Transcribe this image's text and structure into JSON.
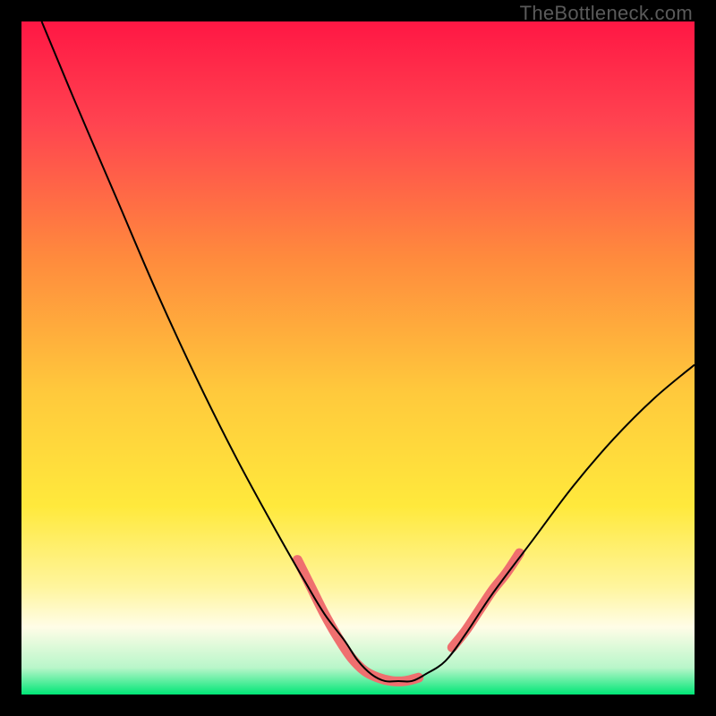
{
  "watermark": "TheBottleneck.com",
  "chart_data": {
    "type": "line",
    "title": "",
    "xlabel": "",
    "ylabel": "",
    "xlim": [
      0,
      100
    ],
    "ylim": [
      0,
      100
    ],
    "background_gradient": {
      "type": "vertical",
      "stops": [
        {
          "pos": 0.0,
          "color": "#ff1744"
        },
        {
          "pos": 0.15,
          "color": "#ff4350"
        },
        {
          "pos": 0.35,
          "color": "#ff8a3d"
        },
        {
          "pos": 0.55,
          "color": "#ffc93c"
        },
        {
          "pos": 0.72,
          "color": "#ffe93c"
        },
        {
          "pos": 0.84,
          "color": "#fff59d"
        },
        {
          "pos": 0.9,
          "color": "#fffde7"
        },
        {
          "pos": 0.96,
          "color": "#b9f6ca"
        },
        {
          "pos": 1.0,
          "color": "#00e676"
        }
      ]
    },
    "series": [
      {
        "name": "bottleneck-curve",
        "type": "line",
        "color": "#000000",
        "width": 2,
        "x": [
          3,
          8,
          14,
          20,
          26,
          32,
          38,
          42,
          45,
          48,
          50,
          52,
          54,
          56,
          58,
          60,
          63,
          66,
          70,
          76,
          82,
          88,
          94,
          100
        ],
        "y": [
          100,
          88,
          74,
          60,
          47,
          35,
          24,
          17,
          12,
          8,
          5,
          3,
          2,
          2,
          2,
          3,
          5,
          9,
          15,
          23,
          31,
          38,
          44,
          49
        ]
      },
      {
        "name": "highlight-band-left",
        "type": "line",
        "color": "#ef6f6f",
        "width": 11,
        "linecap": "round",
        "x": [
          41,
          43,
          45,
          47,
          49,
          51,
          53,
          55,
          57,
          59
        ],
        "y": [
          20,
          16,
          12,
          8.5,
          5.5,
          3.5,
          2.5,
          2,
          2,
          2.5
        ]
      },
      {
        "name": "highlight-band-right",
        "type": "line",
        "color": "#ef6f6f",
        "width": 11,
        "linecap": "round",
        "x": [
          64,
          66,
          68,
          70,
          72,
          74
        ],
        "y": [
          7,
          9.5,
          12.5,
          15.5,
          18,
          21
        ]
      }
    ]
  }
}
